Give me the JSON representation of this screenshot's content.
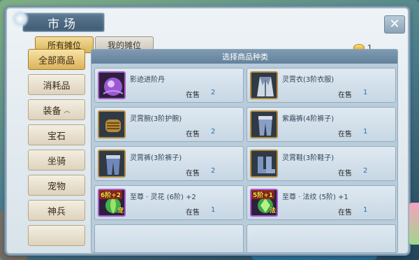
{
  "window": {
    "title": "市场",
    "close_label": "✕"
  },
  "currency": {
    "icon": "gold-ingot-icon",
    "amount": "1"
  },
  "tabs": [
    {
      "label": "所有摊位",
      "active": true
    },
    {
      "label": "我的摊位",
      "active": false
    }
  ],
  "sidebar": {
    "items": [
      {
        "label": "全部商品",
        "active": true
      },
      {
        "label": "消耗品",
        "active": false
      },
      {
        "label": "装备",
        "active": false,
        "expanded": true
      },
      {
        "label": "宝石",
        "active": false
      },
      {
        "label": "坐骑",
        "active": false
      },
      {
        "label": "宠物",
        "active": false
      },
      {
        "label": "神兵",
        "active": false
      }
    ]
  },
  "content": {
    "header": "选择商品种类",
    "items": [
      {
        "name": "影迹进阶丹",
        "status": "在售",
        "count": "2",
        "icon": "purple-orb-icon"
      },
      {
        "name": "灵霄衣(3阶衣服)",
        "status": "在售",
        "count": "1",
        "icon": "robe-icon"
      },
      {
        "name": "灵霄腕(3阶护腕)",
        "status": "在售",
        "count": "2",
        "icon": "bracer-icon"
      },
      {
        "name": "紫霜裤(4阶裤子)",
        "status": "在售",
        "count": "1",
        "icon": "pants-icon"
      },
      {
        "name": "灵霄裤(3阶裤子)",
        "status": "在售",
        "count": "2",
        "icon": "pants-icon"
      },
      {
        "name": "灵霄鞋(3阶鞋子)",
        "status": "在售",
        "count": "2",
        "icon": "boots-icon"
      },
      {
        "name": "至尊 · 灵花 (6阶) +2",
        "status": "在售",
        "count": "1",
        "icon": "spirit-flower-icon",
        "rank_tag": "6阶+2",
        "rank_char": "宠"
      },
      {
        "name": "至尊 · 法纹 (5阶) +1",
        "status": "在售",
        "count": "1",
        "icon": "rune-icon",
        "rank_tag": "5阶+1",
        "rank_char": "法"
      }
    ]
  },
  "colors": {
    "accent_gold": "#d8b35a",
    "header_blue": "#63819b",
    "count_blue": "#2b6fb0"
  }
}
